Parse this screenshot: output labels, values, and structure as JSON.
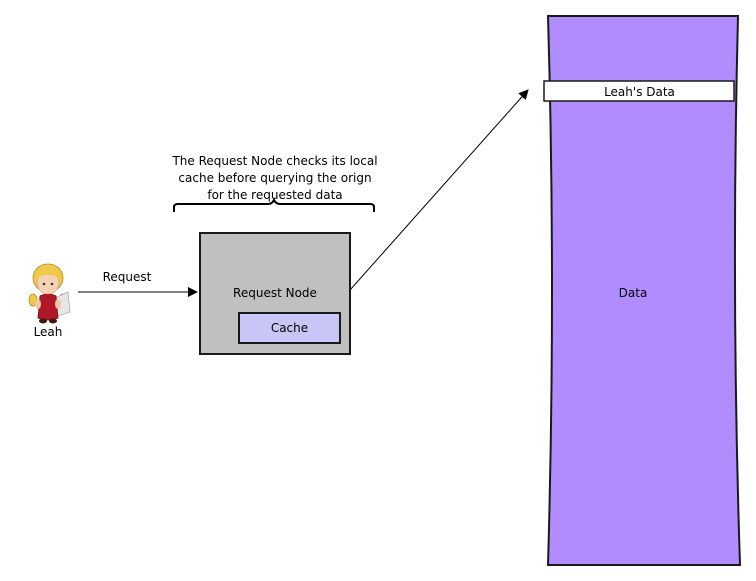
{
  "diagram": {
    "note": {
      "lines": [
        "The Request Node checks its local",
        "cache before querying the orign",
        "for the requested data"
      ]
    },
    "user": {
      "name": "Leah"
    },
    "request_edge": {
      "label": "Request"
    },
    "request_node": {
      "label": "Request Node",
      "cache_label": "Cache"
    },
    "datastore": {
      "label": "Data",
      "record_label": "Leah's Data"
    },
    "colors": {
      "node_fill": "#c0c0c0",
      "cache_fill": "#c7c6f7",
      "data_fill": "#b18cff",
      "record_fill": "#ffffff",
      "stroke": "#1a1a1a"
    }
  }
}
